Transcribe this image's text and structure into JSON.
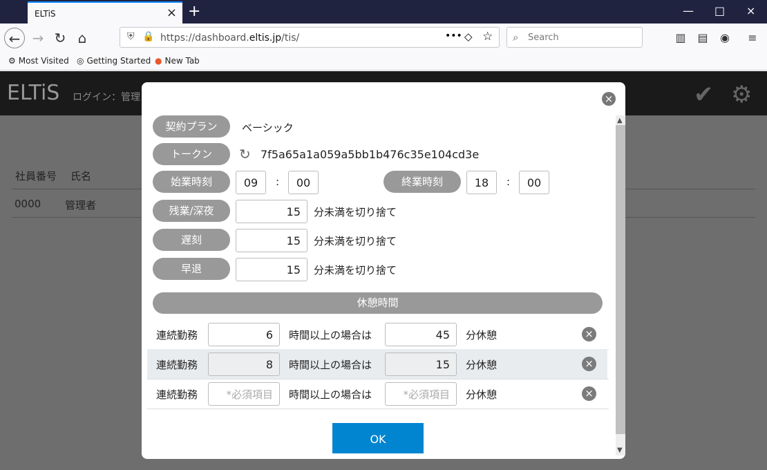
{
  "browser": {
    "tab_title": "ELTiS",
    "url_prefix": "https://dashboard.",
    "url_domain": "eltis.jp",
    "url_suffix": "/tis/",
    "search_placeholder": "Search",
    "bookmarks": [
      "Most Visited",
      "Getting Started",
      "New Tab"
    ]
  },
  "app": {
    "brand": "ELTiS",
    "login_label": "ログイン：管理",
    "table_headers": [
      "社員番号",
      "氏名"
    ],
    "employee_id": "0000",
    "employee_name": "管理者"
  },
  "modal": {
    "plan_label": "契約プラン",
    "plan_value": "ベーシック",
    "token_label": "トークン",
    "token_value": "7f5a65a1a059a5bb1b476c35e104cd3e",
    "start_label": "始業時刻",
    "start_hour": "09",
    "start_min": "00",
    "colon": ":",
    "end_label": "終業時刻",
    "end_hour": "18",
    "end_min": "00",
    "overtime_label": "残業/深夜",
    "late_label": "遅刻",
    "early_label": "早退",
    "rounding_value": "15",
    "rounding_suffix": "分未満を切り捨て",
    "break_header": "休憩時間",
    "break_rows": [
      {
        "label": "連続勤務",
        "hours": "6",
        "middle": "時間以上の場合は",
        "minutes": "45",
        "suffix": "分休憩"
      },
      {
        "label": "連続勤務",
        "hours": "8",
        "middle": "時間以上の場合は",
        "minutes": "15",
        "suffix": "分休憩"
      },
      {
        "label": "連続勤務",
        "hours_placeholder": "*必須項目",
        "middle": "時間以上の場合は",
        "minutes_placeholder": "*必須項目",
        "suffix": "分休憩"
      }
    ],
    "ok": "OK"
  }
}
